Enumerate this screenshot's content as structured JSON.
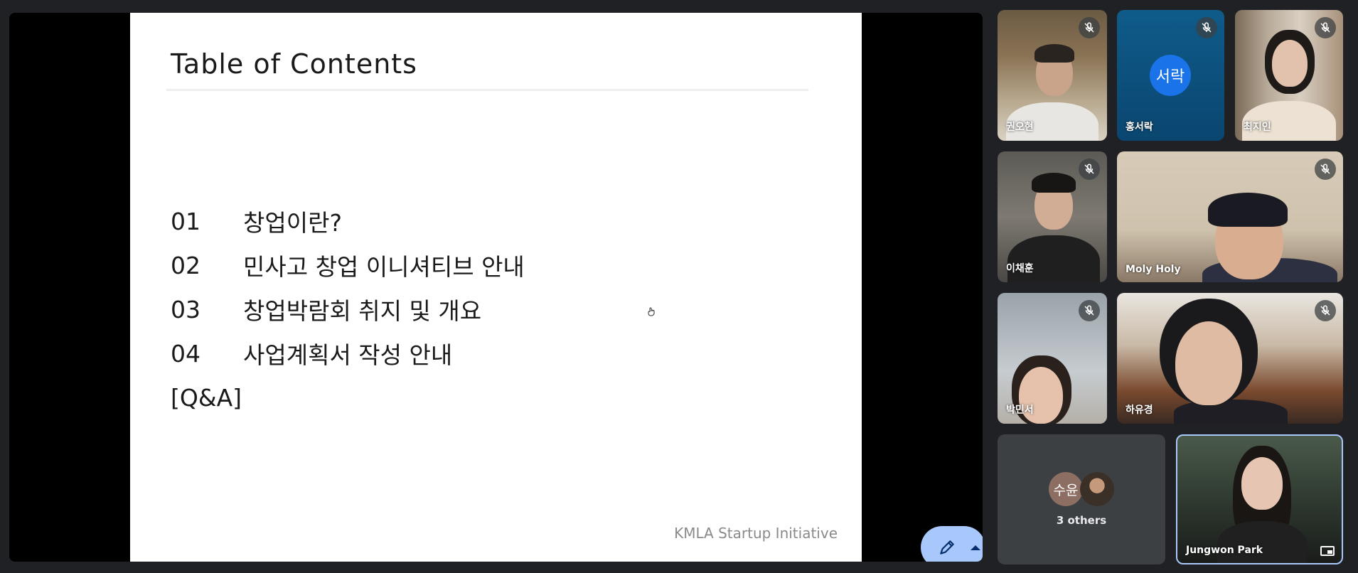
{
  "slide": {
    "title": "Table of Contents",
    "items": [
      {
        "num": "01",
        "label": "창업이란?"
      },
      {
        "num": "02",
        "label": "민사고 창업 이니셔티브 안내"
      },
      {
        "num": "03",
        "label": "창업박람회 취지 및 개요"
      },
      {
        "num": "04",
        "label": "사업계획서 작성 안내"
      }
    ],
    "qa": "[Q&A]",
    "footer": "KMLA Startup Initiative"
  },
  "participants": [
    {
      "name": "권오현",
      "muted": true
    },
    {
      "name": "홍서락",
      "muted": true,
      "avatar_text": "서락",
      "avatar_color": "#1a73e8"
    },
    {
      "name": "최지인",
      "muted": true
    },
    {
      "name": "이채훈",
      "muted": true
    },
    {
      "name": "Moly Holy",
      "muted": true
    },
    {
      "name": "박민서",
      "muted": true
    },
    {
      "name": "하유경",
      "muted": true
    }
  ],
  "others": {
    "avatar_text": "수윤",
    "label": "3 others"
  },
  "self": {
    "name": "Jungwon Park"
  },
  "icons": {
    "mute": "mic-off-icon",
    "annotate": "pen-icon",
    "pip": "picture-in-picture-icon"
  },
  "colors": {
    "background": "#202124",
    "accent": "#a8c7fa"
  }
}
